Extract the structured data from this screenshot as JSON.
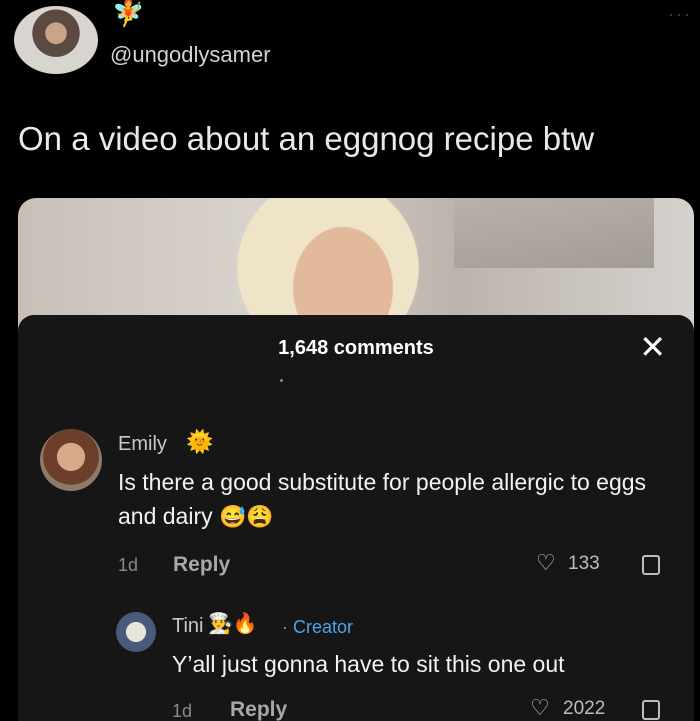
{
  "tweet": {
    "handle": "@ungodlysamer",
    "text": "On a video about an eggnog recipe btw",
    "fairy_emoji": "🧚",
    "more": "···"
  },
  "comments_panel": {
    "count_label": "1,648 comments",
    "close": "✕"
  },
  "comments": [
    {
      "name": "Emily",
      "badge": "🌞",
      "text": "Is there a good substitute for people allergic to eggs and dairy",
      "emojis": "😅😩",
      "time": "1d",
      "reply": "Reply",
      "likes": "133"
    },
    {
      "name": "Tini",
      "badges": "👨‍🍳🔥",
      "creator": "· Creator",
      "text": "Y’all just gonna have to sit this one out",
      "time": "1d",
      "reply": "Reply",
      "likes": "2022"
    }
  ],
  "colors": {
    "background": "#000000",
    "panel": "#161616",
    "creator": "#4fa3e8"
  }
}
